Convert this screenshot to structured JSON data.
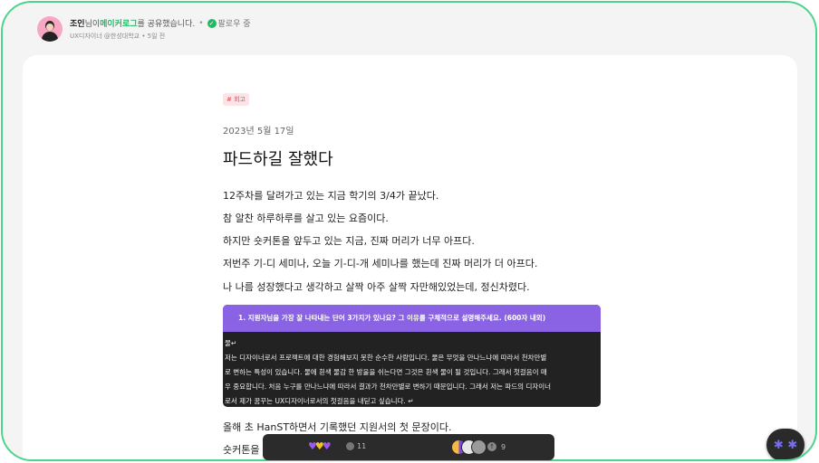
{
  "share": {
    "user": "조인",
    "text_before_group": " 님이 ",
    "group": "메이커로그",
    "text_after_group": "를 공유했습니다.",
    "dot": "•",
    "follow_status": "팔로우 중",
    "meta": "UX디자이너 @한성대학교 • 5일 전"
  },
  "post": {
    "tag": "# 회고",
    "date": "2023년 5월 17일",
    "title": "파드하길 잘했다",
    "paragraphs": [
      "12주차를 달려가고 있는 지금 학기의 3/4가 끝났다.",
      "참 알찬 하루하루를 살고 있는 요즘이다.",
      "하지만 숏커톤을 앞두고 있는 지금, 진짜 머리가 너무 아프다.",
      "저번주 기-디 세미나, 오늘 기-디-개 세미나를 했는데 진짜 머리가 더 아프다.",
      "나 나름 성장했다고 생각하고 살짝 아주 살짝 자만해있었는데, 정신차렸다."
    ],
    "embed": {
      "question": "1.   지원자님을 가장 잘 나타내는 단어 3가지가 있나요? 그 이유를 구체적으로 설명해주세요. (600자 내외)",
      "lines": [
        "물↵",
        "저는 디자이너로서 프로젝트에 대한 경험해보지 못한 순수한 사람입니다. 물은 무엇을 만나느냐에 따라서 천차만별",
        "로 변하는 특성이 있습니다. 물에 흰색 물감 한 방울을 쉬는다면 그것은 흰색 물이 될 것입니다. 그래서 첫걸음이 매",
        "우 중요합니다. 처음 누구를 만나느냐에 따라서 결과가 천차만별로 변하기 때문입니다. 그래서 저는 파드의 디자이너",
        "로서 제가 꿈꾸는 UX디자이너로서의 첫걸음을 내딛고 싶습니다. ↵"
      ]
    },
    "after_paragraphs": [
      "올해 초 HanST하면서 기록했던 지원서의 첫 문장이다.",
      "숏커톤을 앞"
    ]
  },
  "reactions": {
    "hearts": [
      "purple-heart",
      "yellow-heart",
      "purple-heart"
    ],
    "reaction_count": "11",
    "view_count": "9"
  },
  "fab": {
    "label": "✱ ✱"
  },
  "colors": {
    "accent_green": "#22b864",
    "frame_border": "#4fd38a",
    "embed_purple": "#8a62e4"
  }
}
